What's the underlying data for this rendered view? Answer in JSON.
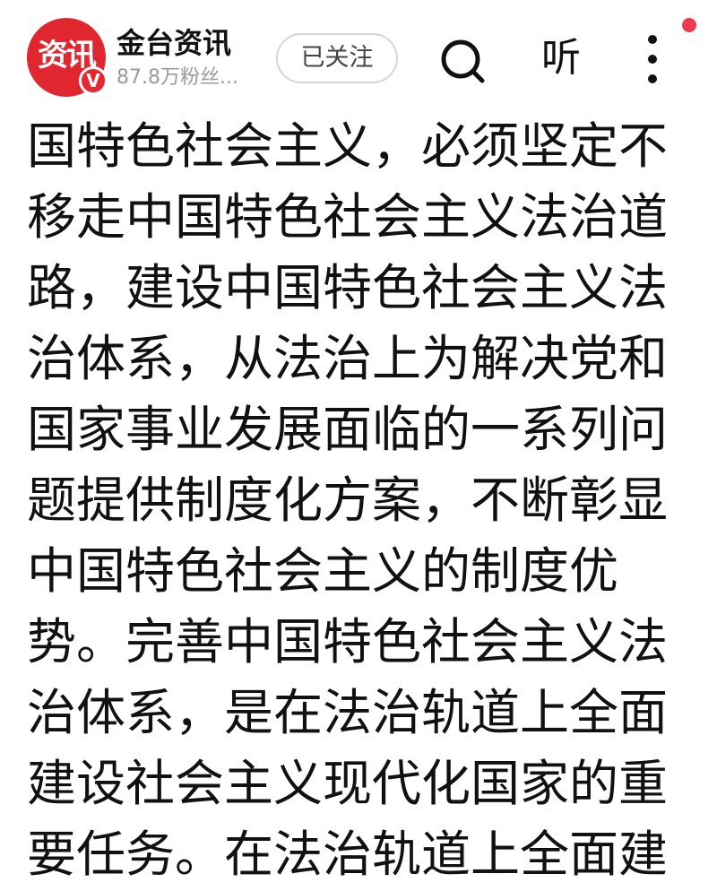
{
  "header": {
    "avatar_text": "资讯",
    "verified_mark": "V",
    "account_name": "金台资讯",
    "followers": "87.8万粉丝...",
    "follow_label": "已关注",
    "listen_label": "听",
    "icons": {
      "search": "search-icon",
      "more": "more-vertical-icon",
      "notification": "notification-dot"
    },
    "colors": {
      "brand_red": "#e0262e",
      "dot_red": "#ee3b50"
    }
  },
  "article": {
    "lines": [
      "国特色社会主义，必须坚定不",
      "移走中国特色社会主义法治道",
      "路，建设中国特色社会主义法",
      "治体系，从法治上为解决党和",
      "国家事业发展面临的一系列问",
      "题提供制度化方案，不断彰显",
      "中国特色社会主义的制度优",
      "势。完善中国特色社会主义法",
      "治体系，是在法治轨道上全面",
      "建设社会主义现代化国家的重",
      "要任务。在法治轨道上全面建"
    ]
  }
}
